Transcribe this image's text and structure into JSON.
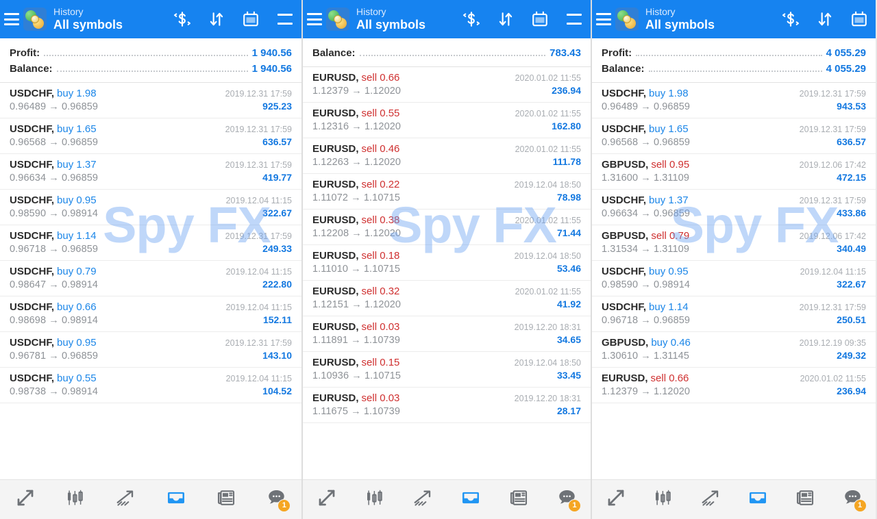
{
  "app": {
    "title_sub": "History",
    "title_main": "All symbols",
    "watermark": "Spy FX",
    "accent_blue": "#1683f0",
    "value_blue": "#1378e0",
    "sell_red": "#cf3030",
    "buy_blue": "#1b86e8",
    "badge_orange": "#f5a623"
  },
  "header_icons": {
    "menu": "hamburger-icon",
    "logo": "app-logo-icon",
    "currency": "currency-exchange-icon",
    "sort": "sort-arrows-icon",
    "calendar": "calendar-icon",
    "list": "list-menu-icon"
  },
  "bottom_nav": [
    {
      "name": "quotes",
      "icon": "quotes-arrows-icon",
      "active": false,
      "badge": ""
    },
    {
      "name": "charts",
      "icon": "candlestick-icon",
      "active": false,
      "badge": ""
    },
    {
      "name": "trade",
      "icon": "trend-arrow-icon",
      "active": false,
      "badge": ""
    },
    {
      "name": "history",
      "icon": "inbox-icon",
      "active": true,
      "badge": ""
    },
    {
      "name": "news",
      "icon": "newspaper-icon",
      "active": false,
      "badge": ""
    },
    {
      "name": "messages",
      "icon": "chat-bubble-icon",
      "active": false,
      "badge": "1"
    }
  ],
  "panels": [
    {
      "id": "panel-1",
      "summary": [
        {
          "label": "Profit:",
          "value": "1 940.56"
        },
        {
          "label": "Balance:",
          "value": "1 940.56"
        }
      ],
      "rows": [
        {
          "symbol": "USDCHF,",
          "side": "buy",
          "volume": "1.98",
          "time": "2019.12.31 17:59",
          "open": "0.96489",
          "close": "0.96859",
          "profit": "925.23"
        },
        {
          "symbol": "USDCHF,",
          "side": "buy",
          "volume": "1.65",
          "time": "2019.12.31 17:59",
          "open": "0.96568",
          "close": "0.96859",
          "profit": "636.57"
        },
        {
          "symbol": "USDCHF,",
          "side": "buy",
          "volume": "1.37",
          "time": "2019.12.31 17:59",
          "open": "0.96634",
          "close": "0.96859",
          "profit": "419.77"
        },
        {
          "symbol": "USDCHF,",
          "side": "buy",
          "volume": "0.95",
          "time": "2019.12.04 11:15",
          "open": "0.98590",
          "close": "0.98914",
          "profit": "322.67"
        },
        {
          "symbol": "USDCHF,",
          "side": "buy",
          "volume": "1.14",
          "time": "2019.12.31 17:59",
          "open": "0.96718",
          "close": "0.96859",
          "profit": "249.33"
        },
        {
          "symbol": "USDCHF,",
          "side": "buy",
          "volume": "0.79",
          "time": "2019.12.04 11:15",
          "open": "0.98647",
          "close": "0.98914",
          "profit": "222.80"
        },
        {
          "symbol": "USDCHF,",
          "side": "buy",
          "volume": "0.66",
          "time": "2019.12.04 11:15",
          "open": "0.98698",
          "close": "0.98914",
          "profit": "152.11"
        },
        {
          "symbol": "USDCHF,",
          "side": "buy",
          "volume": "0.95",
          "time": "2019.12.31 17:59",
          "open": "0.96781",
          "close": "0.96859",
          "profit": "143.10"
        },
        {
          "symbol": "USDCHF,",
          "side": "buy",
          "volume": "0.55",
          "time": "2019.12.04 11:15",
          "open": "0.98738",
          "close": "0.98914",
          "profit": "104.52"
        }
      ]
    },
    {
      "id": "panel-2",
      "summary": [
        {
          "label": "Balance:",
          "value": "783.43"
        }
      ],
      "rows": [
        {
          "symbol": "EURUSD,",
          "side": "sell",
          "volume": "0.66",
          "time": "2020.01.02 11:55",
          "open": "1.12379",
          "close": "1.12020",
          "profit": "236.94"
        },
        {
          "symbol": "EURUSD,",
          "side": "sell",
          "volume": "0.55",
          "time": "2020.01.02 11:55",
          "open": "1.12316",
          "close": "1.12020",
          "profit": "162.80"
        },
        {
          "symbol": "EURUSD,",
          "side": "sell",
          "volume": "0.46",
          "time": "2020.01.02 11:55",
          "open": "1.12263",
          "close": "1.12020",
          "profit": "111.78"
        },
        {
          "symbol": "EURUSD,",
          "side": "sell",
          "volume": "0.22",
          "time": "2019.12.04 18:50",
          "open": "1.11072",
          "close": "1.10715",
          "profit": "78.98"
        },
        {
          "symbol": "EURUSD,",
          "side": "sell",
          "volume": "0.38",
          "time": "2020.01.02 11:55",
          "open": "1.12208",
          "close": "1.12020",
          "profit": "71.44"
        },
        {
          "symbol": "EURUSD,",
          "side": "sell",
          "volume": "0.18",
          "time": "2019.12.04 18:50",
          "open": "1.11010",
          "close": "1.10715",
          "profit": "53.46"
        },
        {
          "symbol": "EURUSD,",
          "side": "sell",
          "volume": "0.32",
          "time": "2020.01.02 11:55",
          "open": "1.12151",
          "close": "1.12020",
          "profit": "41.92"
        },
        {
          "symbol": "EURUSD,",
          "side": "sell",
          "volume": "0.03",
          "time": "2019.12.20 18:31",
          "open": "1.11891",
          "close": "1.10739",
          "profit": "34.65"
        },
        {
          "symbol": "EURUSD,",
          "side": "sell",
          "volume": "0.15",
          "time": "2019.12.04 18:50",
          "open": "1.10936",
          "close": "1.10715",
          "profit": "33.45"
        },
        {
          "symbol": "EURUSD,",
          "side": "sell",
          "volume": "0.03",
          "time": "2019.12.20 18:31",
          "open": "1.11675",
          "close": "1.10739",
          "profit": "28.17"
        }
      ]
    },
    {
      "id": "panel-3",
      "summary": [
        {
          "label": "Profit:",
          "value": "4 055.29"
        },
        {
          "label": "Balance:",
          "value": "4 055.29"
        }
      ],
      "rows": [
        {
          "symbol": "USDCHF,",
          "side": "buy",
          "volume": "1.98",
          "time": "2019.12.31 17:59",
          "open": "0.96489",
          "close": "0.96859",
          "profit": "943.53"
        },
        {
          "symbol": "USDCHF,",
          "side": "buy",
          "volume": "1.65",
          "time": "2019.12.31 17:59",
          "open": "0.96568",
          "close": "0.96859",
          "profit": "636.57"
        },
        {
          "symbol": "GBPUSD,",
          "side": "sell",
          "volume": "0.95",
          "time": "2019.12.06 17:42",
          "open": "1.31600",
          "close": "1.31109",
          "profit": "472.15"
        },
        {
          "symbol": "USDCHF,",
          "side": "buy",
          "volume": "1.37",
          "time": "2019.12.31 17:59",
          "open": "0.96634",
          "close": "0.96859",
          "profit": "433.86"
        },
        {
          "symbol": "GBPUSD,",
          "side": "sell",
          "volume": "0.79",
          "time": "2019.12.06 17:42",
          "open": "1.31534",
          "close": "1.31109",
          "profit": "340.49"
        },
        {
          "symbol": "USDCHF,",
          "side": "buy",
          "volume": "0.95",
          "time": "2019.12.04 11:15",
          "open": "0.98590",
          "close": "0.98914",
          "profit": "322.67"
        },
        {
          "symbol": "USDCHF,",
          "side": "buy",
          "volume": "1.14",
          "time": "2019.12.31 17:59",
          "open": "0.96718",
          "close": "0.96859",
          "profit": "250.51"
        },
        {
          "symbol": "GBPUSD,",
          "side": "buy",
          "volume": "0.46",
          "time": "2019.12.19 09:35",
          "open": "1.30610",
          "close": "1.31145",
          "profit": "249.32"
        },
        {
          "symbol": "EURUSD,",
          "side": "sell",
          "volume": "0.66",
          "time": "2020.01.02 11:55",
          "open": "1.12379",
          "close": "1.12020",
          "profit": "236.94"
        }
      ]
    }
  ]
}
